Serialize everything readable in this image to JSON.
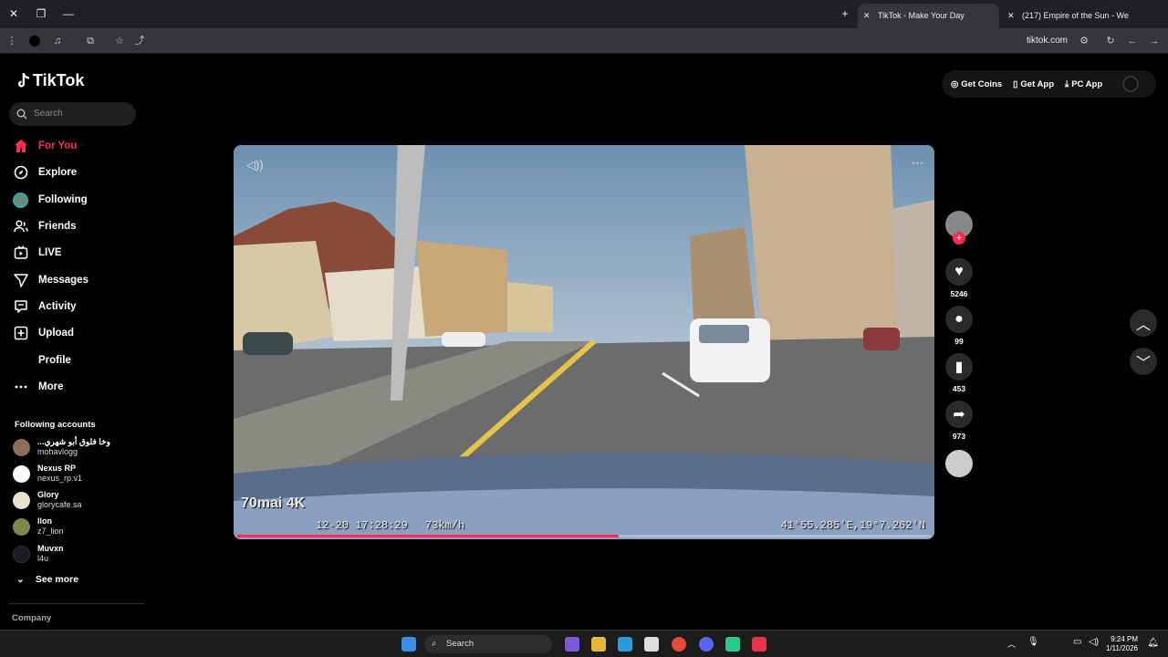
{
  "browser": {
    "tabs": [
      {
        "title": "TikTok - Make Your Day",
        "active": true
      },
      {
        "title": "(217) Empire of the Sun - We",
        "active": false
      }
    ],
    "url": "tiktok.com"
  },
  "sidebar": {
    "logo": "TikTok",
    "search_placeholder": "Search",
    "nav": [
      {
        "label": "For You",
        "icon": "home-icon",
        "active": true
      },
      {
        "label": "Explore",
        "icon": "compass-icon"
      },
      {
        "label": "Following",
        "icon": "following-avatar-icon"
      },
      {
        "label": "Friends",
        "icon": "friends-icon"
      },
      {
        "label": "LIVE",
        "icon": "live-icon"
      },
      {
        "label": "Messages",
        "icon": "send-icon"
      },
      {
        "label": "Activity",
        "icon": "activity-icon"
      },
      {
        "label": "Upload",
        "icon": "plus-square-icon"
      },
      {
        "label": "Profile",
        "icon": "profile-icon"
      },
      {
        "label": "More",
        "icon": "more-icon"
      }
    ],
    "following_title": "Following accounts",
    "accounts": [
      {
        "name": "...وخا فلوق أبو شهري",
        "handle": "mohavlogg"
      },
      {
        "name": "Nexus RP",
        "handle": "nexus_rp.v1"
      },
      {
        "name": "Glory",
        "handle": "glorycafe.sa"
      },
      {
        "name": "llon",
        "handle": "z7_lion"
      },
      {
        "name": "Muvxn",
        "handle": "l4u"
      }
    ],
    "see_more": "See more",
    "company": "Company"
  },
  "top_right": {
    "get_coins": "Get Coins",
    "get_app": "Get App",
    "pc_app": "PC App"
  },
  "video": {
    "brand": "70mai 4K",
    "datetime": "12-20 17:28:29",
    "speed": "73km/h",
    "coords": "41°55.285'E,19°7.262'N",
    "progress": 0.55
  },
  "actions": {
    "likes": "5246",
    "comments": "99",
    "saves": "453",
    "shares": "973"
  },
  "taskbar": {
    "search": "Search",
    "time": "9:24 PM",
    "date": "1/11/2026"
  },
  "colors": {
    "accent": "#fe2c55",
    "bg": "#000000"
  }
}
